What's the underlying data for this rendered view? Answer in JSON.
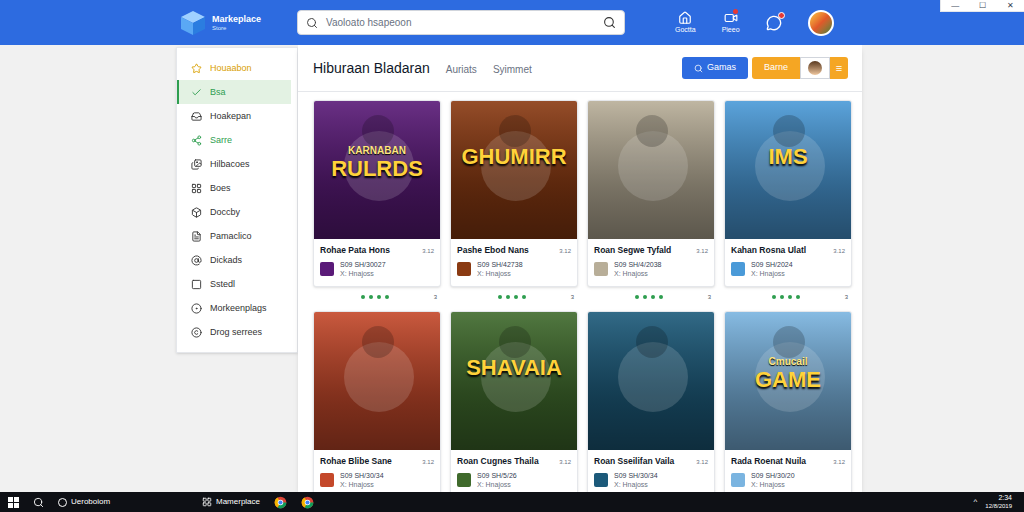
{
  "window": {
    "controls": [
      "—",
      "☐",
      "✕"
    ]
  },
  "header": {
    "logo": {
      "title": "Markeplace",
      "subtitle": "Store"
    },
    "search": {
      "placeholder": "Vaoloato hsapeoon"
    },
    "nav": [
      {
        "label": "Goctta",
        "badge": false
      },
      {
        "label": "Pieeo",
        "badge": true
      }
    ],
    "chat": {
      "badge": true
    }
  },
  "sidebar": {
    "items": [
      {
        "label": "Houaabon",
        "selected": false,
        "color": "#d9a000"
      },
      {
        "label": "Bsa",
        "selected": true,
        "color": "#2e9e4f"
      },
      {
        "label": "Hoakepan",
        "selected": false,
        "color": "#333333"
      },
      {
        "label": "Sarre",
        "selected": false,
        "color": "#2e9e4f"
      },
      {
        "label": "Hilbacoes",
        "selected": false,
        "color": "#333333"
      },
      {
        "label": "Boes",
        "selected": false,
        "color": "#333333"
      },
      {
        "label": "Doccby",
        "selected": false,
        "color": "#333333"
      },
      {
        "label": "Pamaclico",
        "selected": false,
        "color": "#333333"
      },
      {
        "label": "Dickads",
        "selected": false,
        "color": "#333333"
      },
      {
        "label": "Sstedl",
        "selected": false,
        "color": "#333333"
      },
      {
        "label": "Morkeenplags",
        "selected": false,
        "color": "#333333"
      },
      {
        "label": "Drog serrees",
        "selected": false,
        "color": "#333333"
      }
    ]
  },
  "content": {
    "tabs": [
      {
        "label": "Hiburaan Bladaran",
        "selected": true
      },
      {
        "label": "Auriats",
        "selected": false
      },
      {
        "label": "Syimmet",
        "selected": false
      }
    ],
    "actions": {
      "search_button": "Gamas",
      "secondary_button": "Barne",
      "menu_glyph": "≡"
    }
  },
  "cards": [
    {
      "title": "Rohae Pata Hons",
      "badge": "3.12",
      "code": "S09 SH/30027",
      "seller": "X: Hnajoss",
      "color": "#5a1a78",
      "art_text": [
        "KARNABAN",
        "RULRDS"
      ],
      "stars": 4,
      "count": "3"
    },
    {
      "title": "Pashe Ebod Nans",
      "badge": "3.12",
      "code": "S09 SH/42738",
      "seller": "X: Hnajoss",
      "color": "#8a3a12",
      "art_text": [
        "GHUMIRR"
      ],
      "stars": 4,
      "count": "3"
    },
    {
      "title": "Roan Segwe Tyfald",
      "badge": "3.12",
      "code": "S09 SH/4/2038",
      "seller": "X: Hnajoss",
      "color": "#b8ae98",
      "art_text": [],
      "stars": 4,
      "count": "3"
    },
    {
      "title": "Kahan Rosna Ulatl",
      "badge": "3.12",
      "code": "S09 SH/2024",
      "seller": "X: Hnajoss",
      "color": "#4a9ad8",
      "art_text": [
        "IMS"
      ],
      "stars": 4,
      "count": "3"
    },
    {
      "title": "Rohae Blibe Sane",
      "badge": "3.12",
      "code": "S09 SH/30/34",
      "seller": "X: Hnajoss",
      "color": "#c4482a",
      "art_text": [],
      "stars": 0,
      "count": ""
    },
    {
      "title": "Roan Cugnes Thaila",
      "badge": "3.12",
      "code": "S09 SH/5/26",
      "seller": "X: Hnajoss",
      "color": "#3f6a2c",
      "art_text": [
        "SHAVAIA"
      ],
      "stars": 0,
      "count": ""
    },
    {
      "title": "Roan Sseilifan Vaila",
      "badge": "3.12",
      "code": "S09 SH/30/34",
      "seller": "X: Hnajoss",
      "color": "#1c5a7a",
      "art_text": [],
      "stars": 0,
      "count": ""
    },
    {
      "title": "Rada Roenat Nuila",
      "badge": "3.12",
      "code": "S09 SH/30/20",
      "seller": "X: Hnajoss",
      "color": "#7ab4e0",
      "art_text": [
        "Cmucail",
        "GAME"
      ],
      "stars": 0,
      "count": ""
    }
  ],
  "taskbar": {
    "search_label": "Ueroboiom",
    "app_label": "Mamerplace",
    "tray_glyph": "^",
    "time": "2:34",
    "date": "12/8/2019"
  }
}
